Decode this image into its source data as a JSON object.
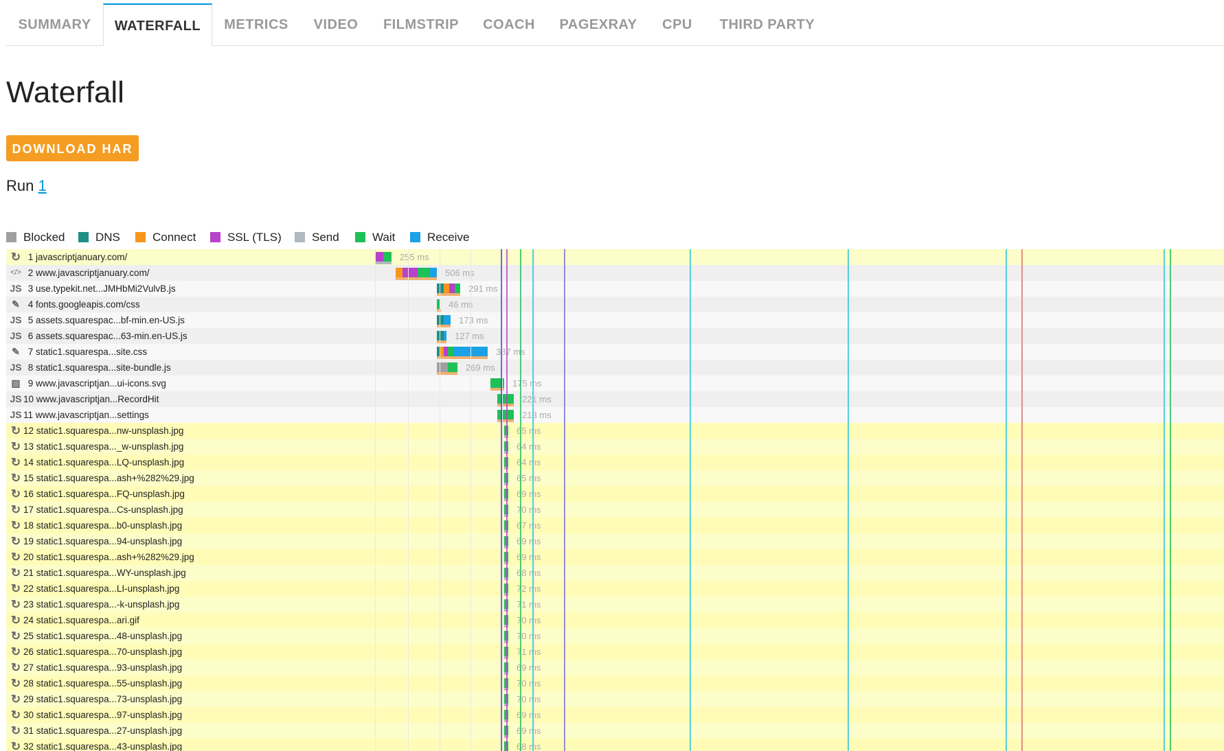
{
  "tabs": [
    "SUMMARY",
    "WATERFALL",
    "METRICS",
    "VIDEO",
    "FILMSTRIP",
    "COACH",
    "PAGEXRAY",
    "CPU",
    "THIRD PARTY"
  ],
  "active_tab": "WATERFALL",
  "page": {
    "title": "Waterfall",
    "download_label": "DOWNLOAD HAR",
    "run_label": "Run",
    "run_link": "1"
  },
  "legend": [
    {
      "label": "Blocked",
      "color": "#a0a0a0"
    },
    {
      "label": "DNS",
      "color": "#1f8f86"
    },
    {
      "label": "Connect",
      "color": "#f7961e"
    },
    {
      "label": "SSL (TLS)",
      "color": "#b842c9"
    },
    {
      "label": "Send",
      "color": "#b0b9c0"
    },
    {
      "label": "Wait",
      "color": "#1ec157"
    },
    {
      "label": "Receive",
      "color": "#1ba1e6"
    }
  ],
  "requests": [
    {
      "num": "1",
      "label": "javascriptjanuary.com/",
      "icon": "redirect-icon",
      "duration": "255 ms",
      "start": 0,
      "phases": {
        "blocked": 0,
        "dns": 0,
        "connect": 0,
        "ssl": 12,
        "send": 0,
        "wait": 12,
        "receive": 0
      },
      "highlight": true
    },
    {
      "num": "2",
      "label": "www.javascriptjanuary.com/",
      "icon": "html-icon",
      "duration": "506 ms",
      "start": 30,
      "phases": {
        "ssl": 22,
        "connect": 10,
        "dns": 0,
        "wait": 18,
        "receive": 10
      },
      "highlight": false
    },
    {
      "num": "3",
      "label": "use.typekit.net...JMHbMi2VulvB.js",
      "icon": "js-icon",
      "duration": "291 ms",
      "start": 90,
      "phases": {
        "dns": 10,
        "connect": 8,
        "ssl": 8,
        "wait": 8,
        "receive": 0
      },
      "highlight": false
    },
    {
      "num": "4",
      "label": "fonts.googleapis.com/css",
      "icon": "css-icon",
      "duration": "46 ms",
      "start": 90,
      "phases": {
        "wait": 5
      },
      "highlight": false
    },
    {
      "num": "5",
      "label": "assets.squarespac...bf-min.en-US.js",
      "icon": "js-icon",
      "duration": "173 ms",
      "start": 90,
      "phases": {
        "dns": 10,
        "receive": 10
      },
      "highlight": false
    },
    {
      "num": "6",
      "label": "assets.squarespac...63-min.en-US.js",
      "icon": "js-icon",
      "duration": "127 ms",
      "start": 90,
      "phases": {
        "dns": 10,
        "receive": 4
      },
      "highlight": false
    },
    {
      "num": "7",
      "label": "static1.squarespa...site.css",
      "icon": "css-icon",
      "duration": "387 ms",
      "start": 90,
      "phases": {
        "ssl": 6,
        "connect": 6,
        "dns": 4,
        "wait": 8,
        "receive": 50
      },
      "highlight": false
    },
    {
      "num": "8",
      "label": "static1.squarespa...site-bundle.js",
      "icon": "js-icon",
      "duration": "269 ms",
      "start": 90,
      "phases": {
        "blocked": 16,
        "wait": 14
      },
      "highlight": false
    },
    {
      "num": "9",
      "label": "www.javascriptjan...ui-icons.svg",
      "icon": "image-icon",
      "duration": "175 ms",
      "start": 168,
      "phases": {
        "wait": 20
      },
      "highlight": false
    },
    {
      "num": "10",
      "label": "www.javascriptjan...RecordHit",
      "icon": "js-icon",
      "duration": "221 ms",
      "start": 178,
      "phases": {
        "wait": 24
      },
      "highlight": false
    },
    {
      "num": "11",
      "label": "www.javascriptjan...settings",
      "icon": "js-icon",
      "duration": "213 ms",
      "start": 178,
      "phases": {
        "wait": 24
      },
      "highlight": false
    },
    {
      "num": "12",
      "label": "static1.squarespa...nw-unsplash.jpg",
      "icon": "redirect-icon",
      "duration": "65 ms",
      "start": 188,
      "phases": {
        "wait": 6
      },
      "highlight": true
    },
    {
      "num": "13",
      "label": "static1.squarespa..._w-unsplash.jpg",
      "icon": "redirect-icon",
      "duration": "64 ms",
      "start": 188,
      "phases": {
        "wait": 6
      },
      "highlight": true
    },
    {
      "num": "14",
      "label": "static1.squarespa...LQ-unsplash.jpg",
      "icon": "redirect-icon",
      "duration": "64 ms",
      "start": 188,
      "phases": {
        "wait": 6
      },
      "highlight": true
    },
    {
      "num": "15",
      "label": "static1.squarespa...ash+%282%29.jpg",
      "icon": "redirect-icon",
      "duration": "65 ms",
      "start": 188,
      "phases": {
        "wait": 6
      },
      "highlight": true
    },
    {
      "num": "16",
      "label": "static1.squarespa...FQ-unsplash.jpg",
      "icon": "redirect-icon",
      "duration": "69 ms",
      "start": 188,
      "phases": {
        "wait": 6
      },
      "highlight": true
    },
    {
      "num": "17",
      "label": "static1.squarespa...Cs-unsplash.jpg",
      "icon": "redirect-icon",
      "duration": "70 ms",
      "start": 188,
      "phases": {
        "wait": 6
      },
      "highlight": true
    },
    {
      "num": "18",
      "label": "static1.squarespa...b0-unsplash.jpg",
      "icon": "redirect-icon",
      "duration": "67 ms",
      "start": 188,
      "phases": {
        "wait": 6
      },
      "highlight": true
    },
    {
      "num": "19",
      "label": "static1.squarespa...94-unsplash.jpg",
      "icon": "redirect-icon",
      "duration": "69 ms",
      "start": 188,
      "phases": {
        "wait": 6
      },
      "highlight": true
    },
    {
      "num": "20",
      "label": "static1.squarespa...ash+%282%29.jpg",
      "icon": "redirect-icon",
      "duration": "69 ms",
      "start": 188,
      "phases": {
        "wait": 6
      },
      "highlight": true
    },
    {
      "num": "21",
      "label": "static1.squarespa...WY-unsplash.jpg",
      "icon": "redirect-icon",
      "duration": "68 ms",
      "start": 188,
      "phases": {
        "wait": 6
      },
      "highlight": true
    },
    {
      "num": "22",
      "label": "static1.squarespa...LI-unsplash.jpg",
      "icon": "redirect-icon",
      "duration": "72 ms",
      "start": 188,
      "phases": {
        "wait": 6
      },
      "highlight": true
    },
    {
      "num": "23",
      "label": "static1.squarespa...-k-unsplash.jpg",
      "icon": "redirect-icon",
      "duration": "71 ms",
      "start": 188,
      "phases": {
        "wait": 6
      },
      "highlight": true
    },
    {
      "num": "24",
      "label": "static1.squarespa...ari.gif",
      "icon": "redirect-icon",
      "duration": "70 ms",
      "start": 188,
      "phases": {
        "wait": 6
      },
      "highlight": true
    },
    {
      "num": "25",
      "label": "static1.squarespa...48-unsplash.jpg",
      "icon": "redirect-icon",
      "duration": "70 ms",
      "start": 188,
      "phases": {
        "wait": 6
      },
      "highlight": true
    },
    {
      "num": "26",
      "label": "static1.squarespa...70-unsplash.jpg",
      "icon": "redirect-icon",
      "duration": "71 ms",
      "start": 188,
      "phases": {
        "wait": 6
      },
      "highlight": true
    },
    {
      "num": "27",
      "label": "static1.squarespa...93-unsplash.jpg",
      "icon": "redirect-icon",
      "duration": "69 ms",
      "start": 188,
      "phases": {
        "wait": 6
      },
      "highlight": true
    },
    {
      "num": "28",
      "label": "static1.squarespa...55-unsplash.jpg",
      "icon": "redirect-icon",
      "duration": "70 ms",
      "start": 188,
      "phases": {
        "wait": 6
      },
      "highlight": true
    },
    {
      "num": "29",
      "label": "static1.squarespa...73-unsplash.jpg",
      "icon": "redirect-icon",
      "duration": "70 ms",
      "start": 188,
      "phases": {
        "wait": 6
      },
      "highlight": true
    },
    {
      "num": "30",
      "label": "static1.squarespa...97-unsplash.jpg",
      "icon": "redirect-icon",
      "duration": "69 ms",
      "start": 188,
      "phases": {
        "wait": 6
      },
      "highlight": true
    },
    {
      "num": "31",
      "label": "static1.squarespa...27-unsplash.jpg",
      "icon": "redirect-icon",
      "duration": "69 ms",
      "start": 188,
      "phases": {
        "wait": 6
      },
      "highlight": true
    },
    {
      "num": "32",
      "label": "static1.squarespa...43-unsplash.jpg",
      "icon": "redirect-icon",
      "duration": "68 ms",
      "start": 188,
      "phases": {
        "wait": 6
      },
      "highlight": true
    }
  ],
  "markers": [
    {
      "kind": "dom-interactive",
      "color": "#4b4bd6"
    },
    {
      "kind": "first-paint",
      "color": "#b842c9"
    },
    {
      "kind": "dom-content-loaded",
      "color": "#1ec157"
    },
    {
      "kind": "load",
      "color": "#2ec4d6"
    },
    {
      "kind": "onload",
      "color": "#7b6ed6"
    },
    {
      "kind": "fully-loaded",
      "color": "#e07070"
    }
  ]
}
